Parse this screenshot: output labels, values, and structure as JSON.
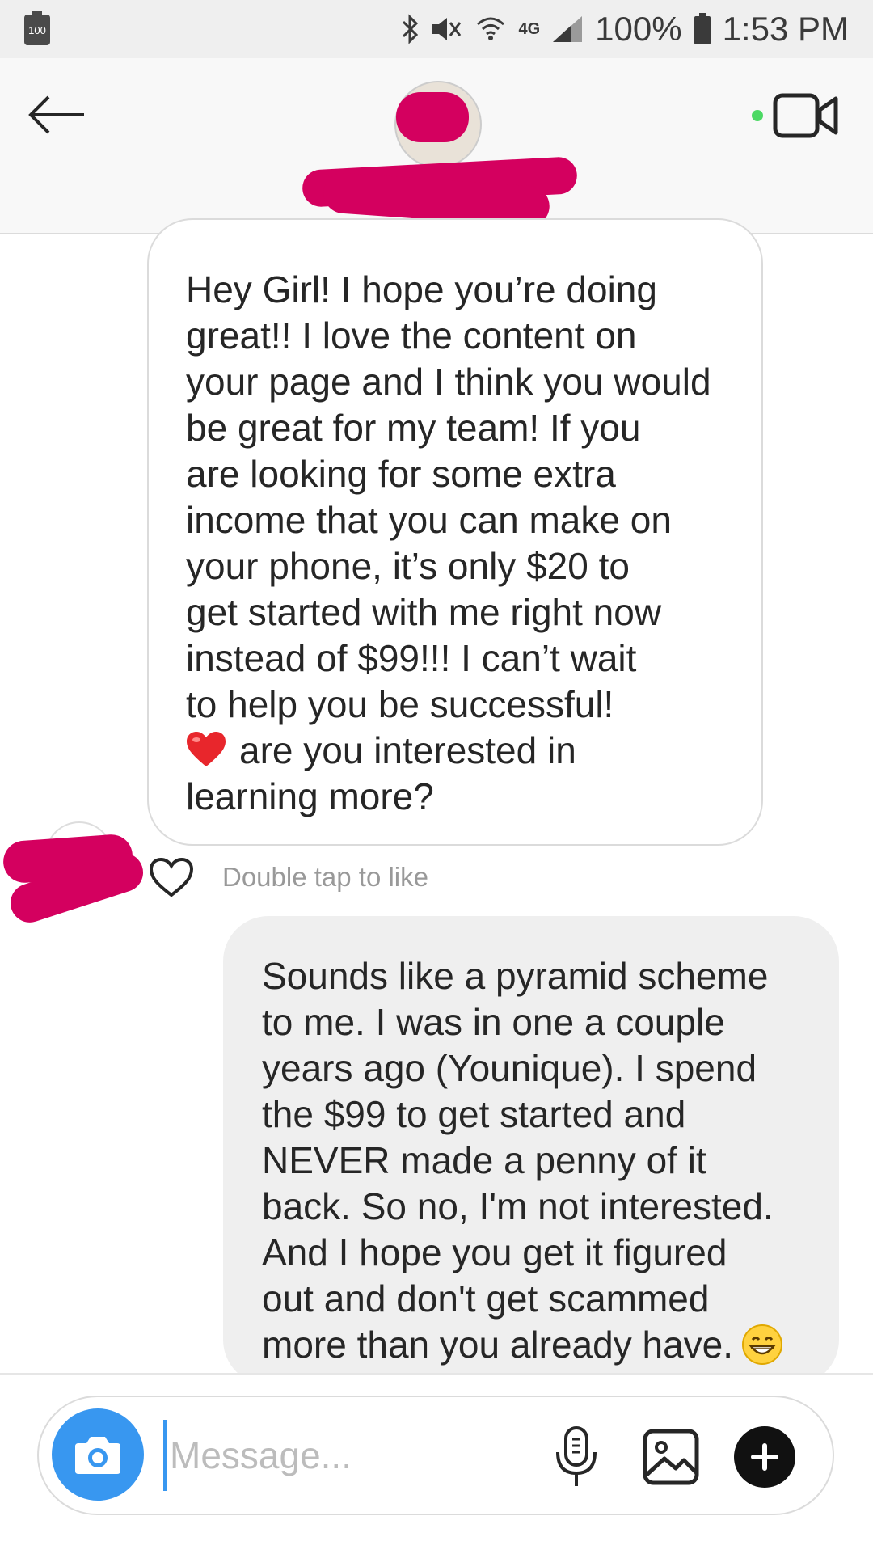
{
  "status_bar": {
    "battery_badge": "100",
    "network": "4G",
    "battery": "100%",
    "time": "1:53 PM",
    "icons": [
      "bluetooth-icon",
      "mute-icon",
      "wifi-icon",
      "signal-icon",
      "battery-icon"
    ]
  },
  "header": {
    "icons": [
      "back-arrow-icon",
      "video-call-icon"
    ],
    "online_color": "#4cd964",
    "redaction_color": "#d4005f"
  },
  "messages": {
    "incoming": {
      "lines": [
        "Hey Girl! I hope you’re doing",
        "great!! I love the content on",
        "your page and I think you would",
        "be great for my team! If you",
        "are looking for some extra",
        "income that you can make on",
        "your phone, it’s only $20 to",
        "get started with me right now",
        "instead of $99!!! I can’t wait",
        "to help you be successful!",
        "are you interested in",
        "learning more?"
      ],
      "emoji": "red-heart-emoji",
      "like_hint": "Double tap to like"
    },
    "outgoing": {
      "lines": [
        "Sounds like a pyramid scheme",
        "to me. I was in one a couple",
        "years ago (Younique). I spend",
        "the $99 to get started and",
        "NEVER made a penny of it",
        "back. So no, I'm not interested.",
        "And I hope you get it figured",
        "out and don't get scammed",
        "more than you already have."
      ],
      "emoji": "grinning-face-emoji"
    }
  },
  "composer": {
    "placeholder": "Message...",
    "value": "",
    "accent": "#3897f0",
    "icons": [
      "camera-icon",
      "microphone-icon",
      "gallery-icon",
      "plus-icon"
    ]
  }
}
